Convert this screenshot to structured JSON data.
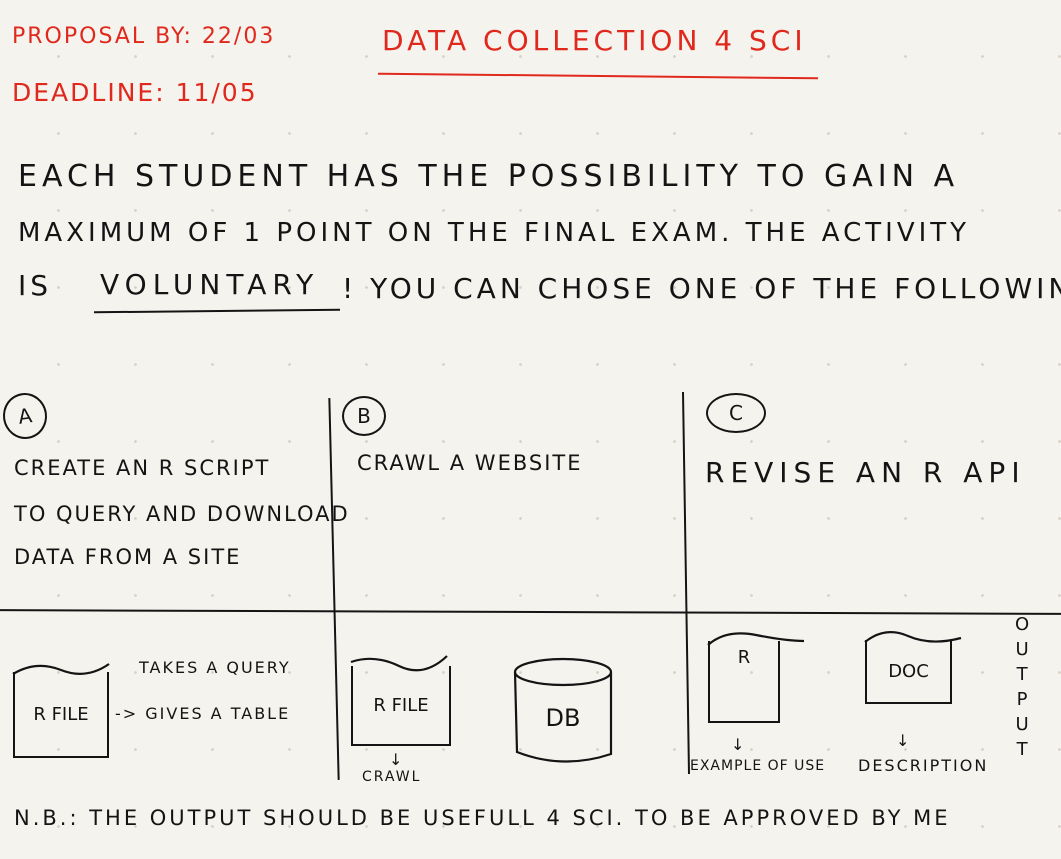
{
  "header": {
    "proposal": "PROPOSAL BY: 22/03",
    "deadline": "DEADLINE: 11/05",
    "title": "DATA COLLECTION 4 SCI"
  },
  "intro": {
    "line1": "EACH STUDENT HAS THE POSSIBILITY TO GAIN A",
    "line2": "MAXIMUM OF 1 POINT ON THE FINAL EXAM. THE ACTIVITY",
    "line3_prefix": "IS",
    "line3_emphasis": "VOLUNTARY",
    "line3_suffix": "! YOU CAN CHOSE ONE OF THE FOLLOWING"
  },
  "options": {
    "a": {
      "marker": "A",
      "line1": "CREATE AN R SCRIPT",
      "line2": "TO QUERY AND DOWNLOAD",
      "line3": "DATA FROM A SITE",
      "file_label": "R FILE",
      "takes": "TAKES A QUERY",
      "gives": "-> GIVES A TABLE"
    },
    "b": {
      "marker": "B",
      "line1": "CRAWL A WEBSITE",
      "file_label": "R FILE",
      "db_label": "DB",
      "crawl": "CRAWL",
      "arrow": "↓"
    },
    "c": {
      "marker": "C",
      "line1": "REVISE AN R API",
      "r_label": "R",
      "doc_label": "DOC",
      "example": "EXAMPLE OF USE",
      "description": "DESCRIPTION",
      "output_letters": [
        "O",
        "U",
        "T",
        "P",
        "U",
        "T"
      ],
      "arrow": "↓"
    }
  },
  "note": "N.B.: THE OUTPUT SHOULD BE USEFULL 4 SCI. TO BE APPROVED BY ME"
}
